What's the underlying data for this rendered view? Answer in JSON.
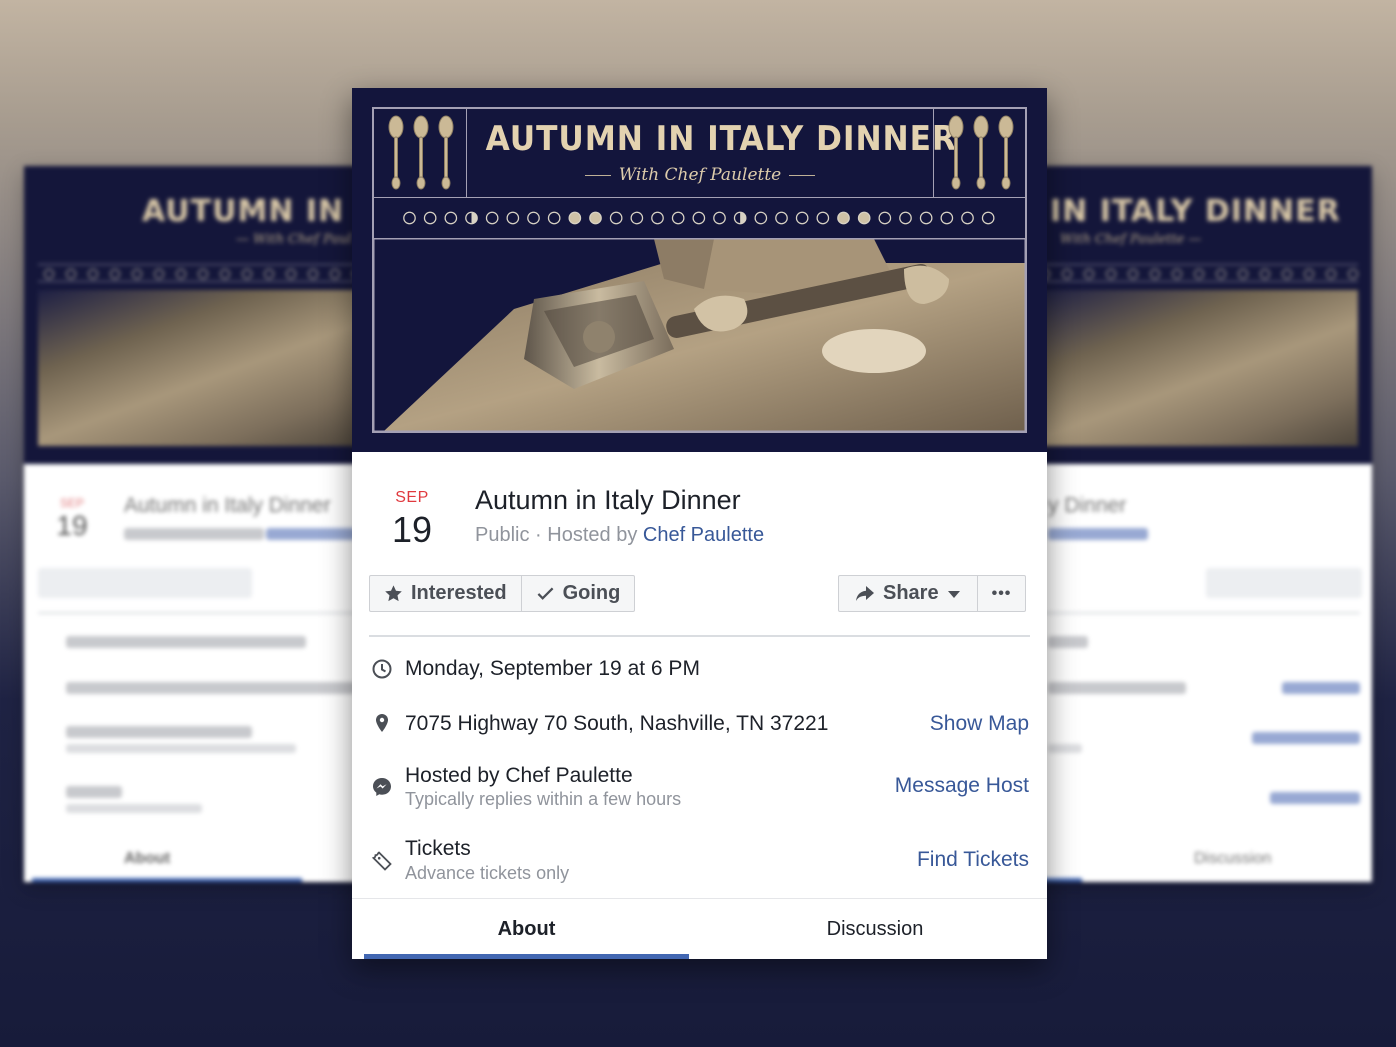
{
  "banner": {
    "title": "AUTUMN IN ITALY DINNER",
    "subtitle": "With Chef Paulette",
    "colors": {
      "navy": "#13153c",
      "gold": "#e3d2b0"
    }
  },
  "event": {
    "month": "SEP",
    "day": "19",
    "title": "Autumn in Italy Dinner",
    "privacy": "Public",
    "separator": " · ",
    "hosted_prefix": "Hosted by ",
    "host_name": "Chef Paulette"
  },
  "actions": {
    "interested_label": "Interested",
    "going_label": "Going",
    "share_label": "Share",
    "more_label": "•••"
  },
  "details": {
    "datetime": "Monday, September 19 at 6 PM",
    "address": "7075 Highway 70 South, Nashville, TN 37221",
    "show_map_label": "Show Map",
    "host_line": "Hosted by Chef Paulette",
    "host_reply": "Typically replies within a few hours",
    "message_host_label": "Message Host",
    "tickets_title": "Tickets",
    "tickets_sub": "Advance tickets only",
    "find_tickets_label": "Find Tickets"
  },
  "tabs": [
    {
      "label": "About",
      "active": true
    },
    {
      "label": "Discussion",
      "active": false
    }
  ],
  "ghost_left": {
    "banner_title": "AUTUMN IN ITAL",
    "banner_subtitle": "— With Chef Paul",
    "month": "SEP",
    "day": "19",
    "title": "Autumn in Italy Dinner",
    "tab": "About"
  },
  "ghost_right": {
    "banner_title": "IN ITALY DINNER",
    "banner_subtitle": "With Chef Paulette —",
    "title": "y Dinner",
    "tab": "Discussion"
  },
  "moon_phases": [
    "new",
    "new",
    "new",
    "half",
    "new",
    "new",
    "new",
    "new",
    "full",
    "full",
    "new",
    "new",
    "new",
    "new",
    "new",
    "new",
    "half",
    "new",
    "new",
    "new",
    "new",
    "full",
    "full",
    "new",
    "new",
    "new",
    "new",
    "new",
    "new"
  ]
}
